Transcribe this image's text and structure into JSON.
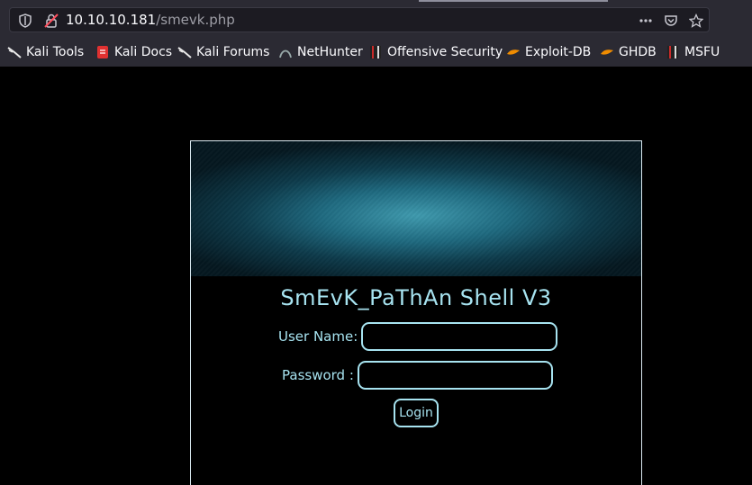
{
  "browser": {
    "url_host": "10.10.10.181",
    "url_path": "/smevk.php"
  },
  "bookmarks": [
    {
      "label": "Kali Tools",
      "icon": "kali-dragon-icon"
    },
    {
      "label": "Kali Docs",
      "icon": "kali-docs-icon"
    },
    {
      "label": "Kali Forums",
      "icon": "kali-dragon-icon"
    },
    {
      "label": "NetHunter",
      "icon": "nethunter-icon"
    },
    {
      "label": "Offensive Security",
      "icon": "offsec-icon"
    },
    {
      "label": "Exploit-DB",
      "icon": "exploitdb-icon"
    },
    {
      "label": "GHDB",
      "icon": "exploitdb-icon"
    },
    {
      "label": "MSFU",
      "icon": "offsec-icon"
    }
  ],
  "page": {
    "title": "SmEvK_PaThAn Shell V3",
    "username_label": "User Name:",
    "password_label": "Password :",
    "login_label": "Login",
    "username_value": "",
    "password_value": ""
  },
  "colors": {
    "accent": "#a7e3f0",
    "chrome_bg": "#2b2a33",
    "url_bg": "#1c1b22"
  }
}
